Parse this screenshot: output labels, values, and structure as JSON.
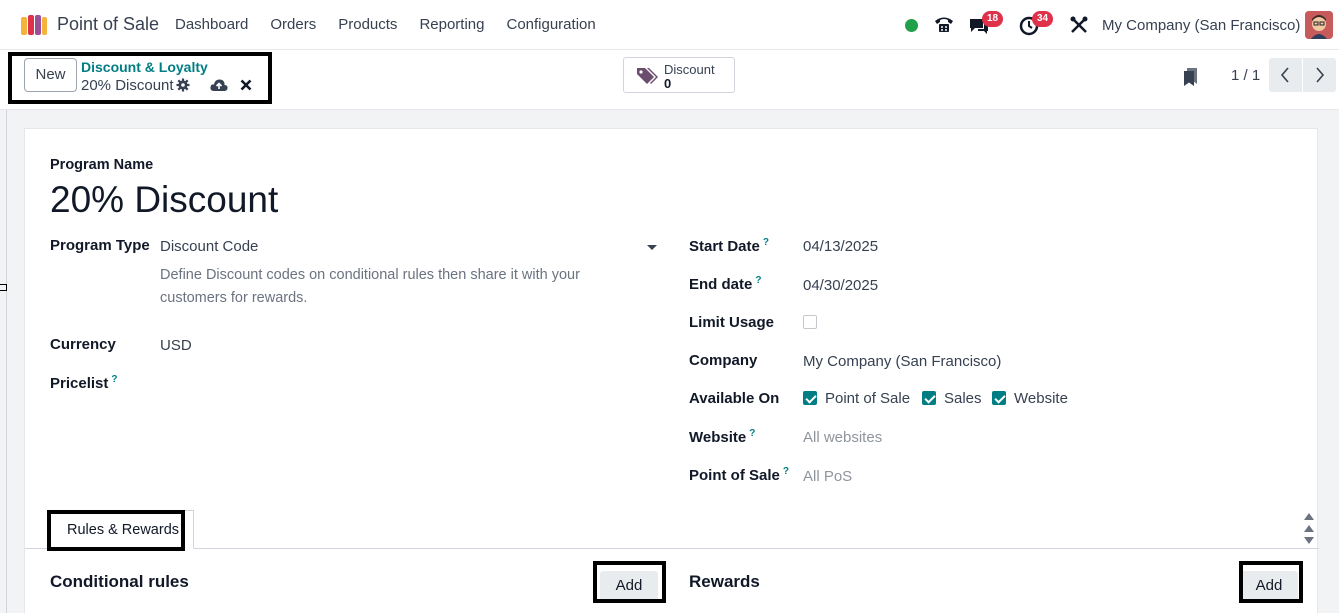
{
  "navbar": {
    "app_name": "Point of Sale",
    "menu": [
      "Dashboard",
      "Orders",
      "Products",
      "Reporting",
      "Configuration"
    ],
    "chat_count": "18",
    "activity_count": "34",
    "company": "My Company (San Francisco)",
    "status_color": "#21a04a"
  },
  "control": {
    "new_label": "New",
    "breadcrumb_parent": "Discount & Loyalty",
    "breadcrumb_current": "20% Discount",
    "smart_button": {
      "label": "Discount",
      "count": "0",
      "icon": "tag-icon"
    },
    "pager": "1 / 1"
  },
  "form": {
    "program_name_label": "Program Name",
    "program_name": "20% Discount",
    "program_type_label": "Program Type",
    "program_type": "Discount Code",
    "program_type_desc": "Define Discount codes on conditional rules then share it with your customers for rewards.",
    "currency_label": "Currency",
    "currency": "USD",
    "pricelist_label": "Pricelist",
    "help_mark": "?",
    "start_date_label": "Start Date",
    "start_date": "04/13/2025",
    "end_date_label": "End date",
    "end_date": "04/30/2025",
    "limit_usage_label": "Limit Usage",
    "limit_usage": false,
    "company_label": "Company",
    "company": "My Company (San Francisco)",
    "available_on_label": "Available On",
    "available_on": [
      {
        "label": "Point of Sale",
        "checked": true
      },
      {
        "label": "Sales",
        "checked": true
      },
      {
        "label": "Website",
        "checked": true
      }
    ],
    "website_label": "Website",
    "website_placeholder": "All websites",
    "pos_label": "Point of Sale",
    "pos_placeholder": "All PoS"
  },
  "tabs": {
    "active": "Rules & Rewards"
  },
  "rules": {
    "conditional_title": "Conditional rules",
    "rewards_title": "Rewards",
    "add_label": "Add"
  },
  "colors": {
    "accent": "#017e84",
    "badge": "#e0314b",
    "highlight_border": "#000000"
  }
}
